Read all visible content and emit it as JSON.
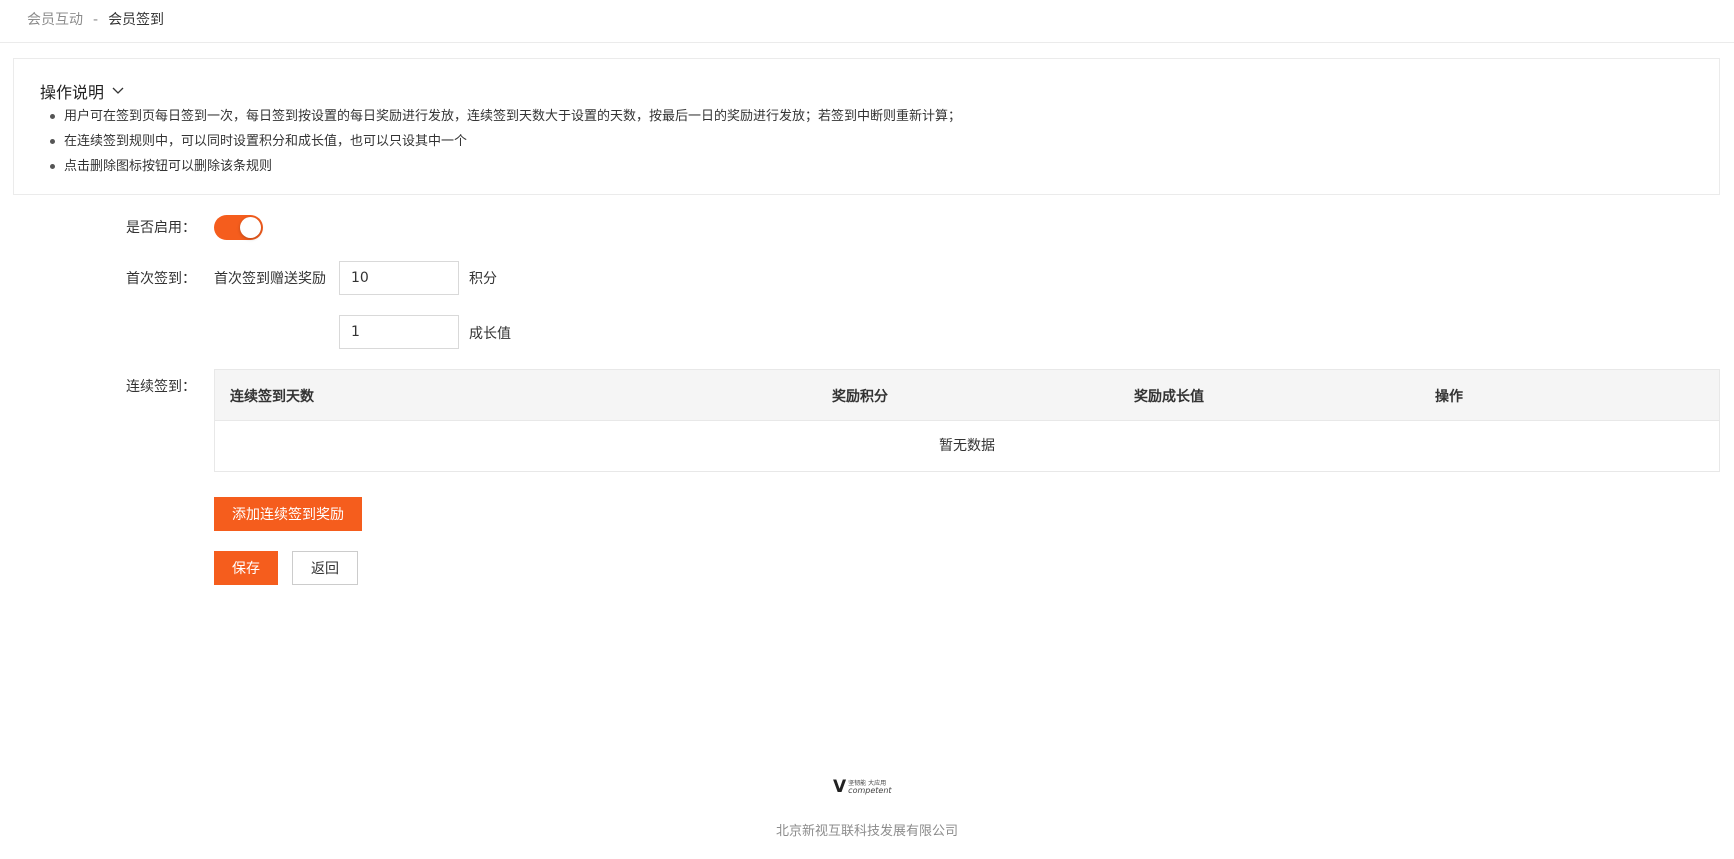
{
  "breadcrumb": {
    "parent": "会员互动",
    "separator": "-",
    "current": "会员签到"
  },
  "help": {
    "title": "操作说明",
    "toggle_icon": "chevron-down-icon",
    "items": [
      "用户可在签到页每日签到一次，每日签到按设置的每日奖励进行发放，连续签到天数大于设置的天数，按最后一日的奖励进行发放；若签到中断则重新计算；",
      "在连续签到规则中，可以同时设置积分和成长值，也可以只设其中一个",
      "点击删除图标按钮可以删除该条规则"
    ]
  },
  "form": {
    "enable_label": "是否启用：",
    "enabled": true,
    "first_signin_label": "首次签到：",
    "first_signin_text": "首次签到赠送奖励",
    "points_value": "10",
    "points_unit": "积分",
    "growth_value": "1",
    "growth_unit": "成长值",
    "continuous_label": "连续签到："
  },
  "table": {
    "columns": [
      "连续签到天数",
      "奖励积分",
      "奖励成长值",
      "操作"
    ],
    "rows": [],
    "empty_text": "暂无数据"
  },
  "buttons": {
    "add_reward": "添加连续签到奖励",
    "save": "保存",
    "back": "返回"
  },
  "footer": {
    "logo_mark": "V",
    "logo_line1": "坚韧能 大应用",
    "logo_line2": "competent",
    "company": "北京新视互联科技发展有限公司"
  },
  "colors": {
    "accent": "#f55d1d",
    "border": "#e8e8e8",
    "header_bg": "#f5f5f5"
  }
}
